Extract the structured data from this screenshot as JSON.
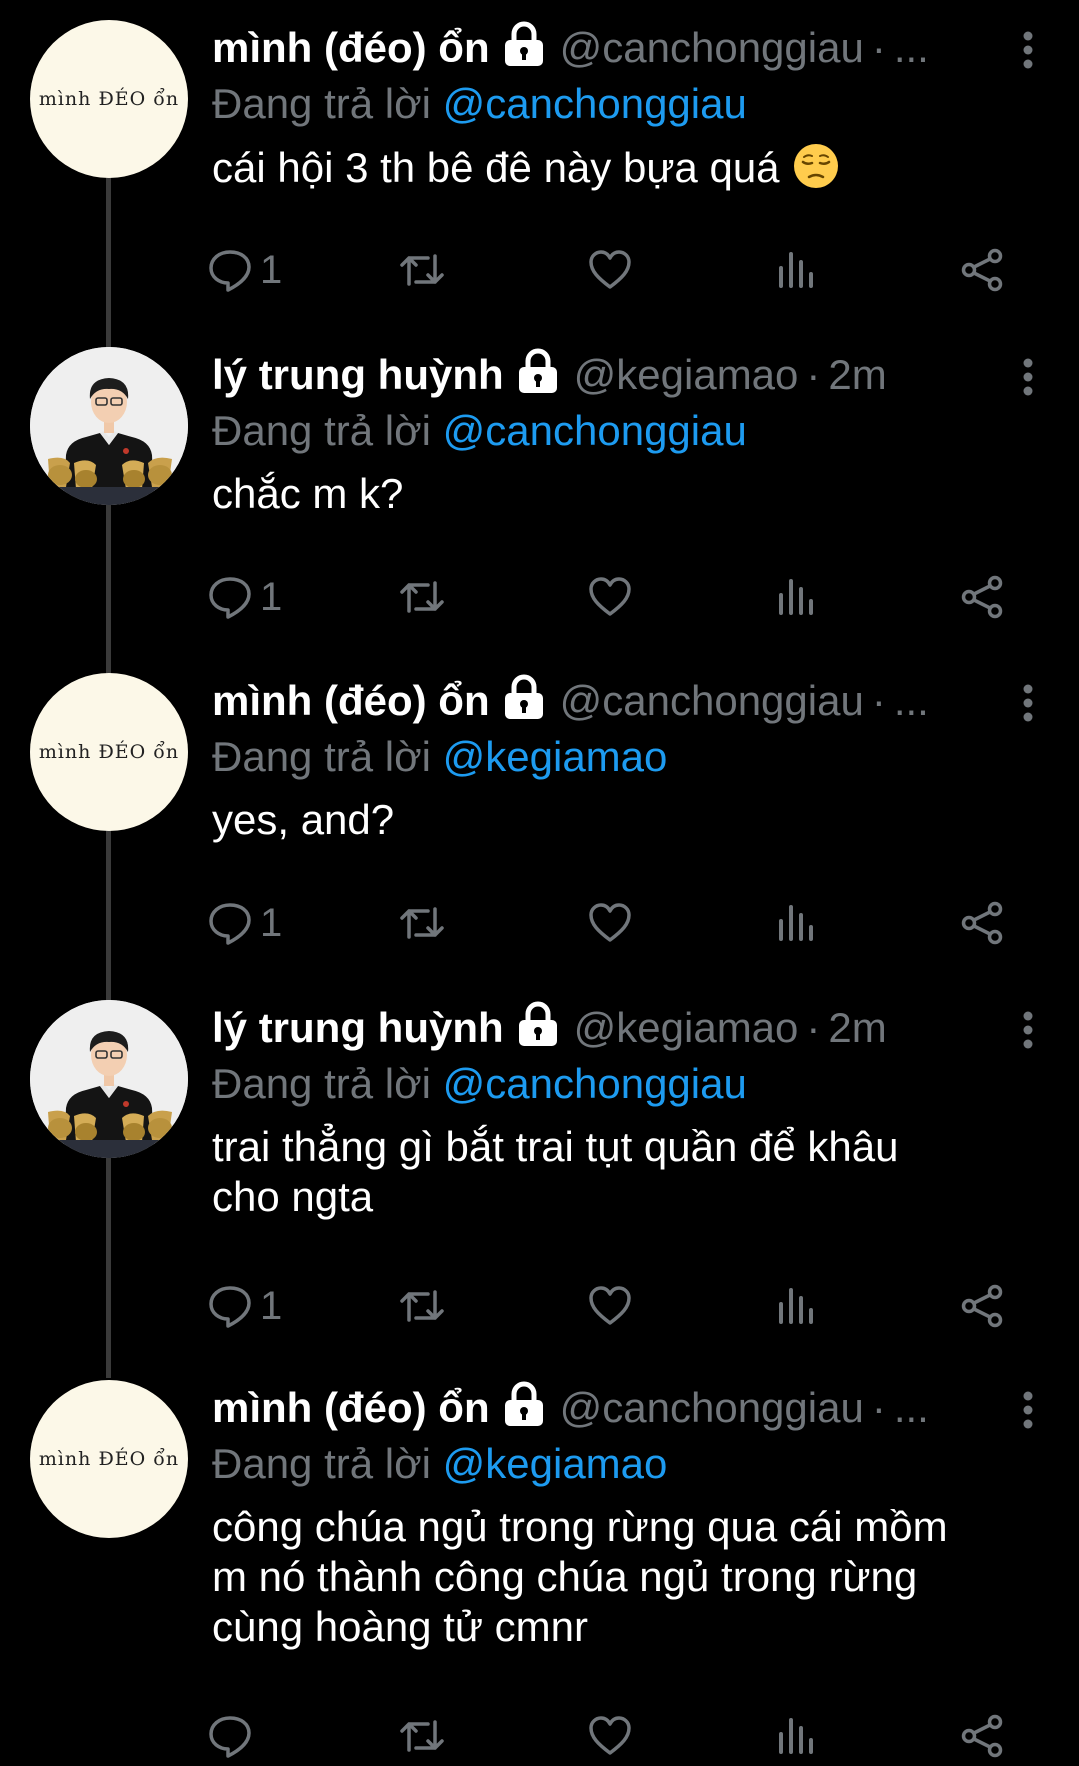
{
  "replying_label": "Đang trả lời ",
  "colors": {
    "background": "#000000",
    "text": "#ffffff",
    "secondary": "#71767b",
    "mention": "#1d9bf0",
    "thread_line": "#3a3a3a",
    "avatar_bg": "#fcf8e8"
  },
  "tweets": [
    {
      "display_name": "mình (đéo) ổn",
      "handle": "@canchonggiau",
      "time": "...",
      "replying_to": "@canchonggiau",
      "text": "cái hội 3 th bê đê này bựa quá",
      "emoji": "pensive-face-icon",
      "reply_count": "1",
      "avatar_text": "mình ĐÉO ổn"
    },
    {
      "display_name": "lý trung huỳnh",
      "handle": "@kegiamao",
      "time": "2m",
      "replying_to": "@canchonggiau",
      "text": "chắc m k?",
      "reply_count": "1"
    },
    {
      "display_name": "mình (đéo) ổn",
      "handle": "@canchonggiau",
      "time": "...",
      "replying_to": "@kegiamao",
      "text": "yes, and?",
      "reply_count": "1",
      "avatar_text": "mình ĐÉO ổn"
    },
    {
      "display_name": "lý trung huỳnh",
      "handle": "@kegiamao",
      "time": "2m",
      "replying_to": "@canchonggiau",
      "text": "trai thẳng gì bắt trai tụt quần để khâu\ncho ngta",
      "reply_count": "1"
    },
    {
      "display_name": "mình (đéo) ổn",
      "handle": "@canchonggiau",
      "time": "...",
      "replying_to": "@kegiamao",
      "text": "công chúa ngủ trong rừng qua cái mồm\nm nó thành công chúa ngủ trong rừng\ncùng hoàng tử cmnr",
      "reply_count": "",
      "avatar_text": "mình ĐÉO ổn"
    }
  ]
}
